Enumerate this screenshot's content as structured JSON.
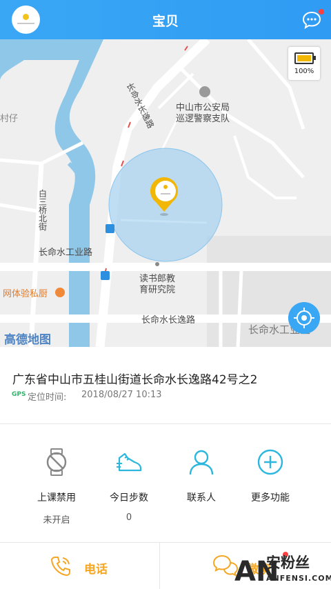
{
  "header": {
    "title": "宝贝"
  },
  "map": {
    "labels": {
      "police": "中山市公安局\n巡逻警察支队",
      "police_line1": "中山市公安局",
      "police_line2": "巡逻警察支队",
      "road_main": "长命水长逸路",
      "road_industrial": "长命水工业路",
      "road_bottom": "长命水长逸路",
      "district_right": "长命水工业区",
      "baisan_road": "白三桥北街",
      "research_line1": "读书郎教",
      "research_line2": "育研究院",
      "kitchen": "网体验私厨",
      "left_edge": "村仔"
    },
    "battery": {
      "percent_label": "100%",
      "level": 1.0
    },
    "logo": "高德地图"
  },
  "location": {
    "address": "广东省中山市五桂山街道长命水长逸路42号之2",
    "source": "GPS",
    "time_label": "定位时间:",
    "time_value": "2018/08/27 10:13"
  },
  "functions": [
    {
      "label": "上课禁用",
      "value": "未开启",
      "icon": "watch-disabled-icon"
    },
    {
      "label": "今日步数",
      "value": "0",
      "icon": "sneaker-icon"
    },
    {
      "label": "联系人",
      "value": "",
      "icon": "person-icon"
    },
    {
      "label": "更多功能",
      "value": "",
      "icon": "plus-circle-icon"
    }
  ],
  "bottom": {
    "call_label": "电话",
    "wechat_label": "微聊"
  },
  "watermark": {
    "main": "安粉丝",
    "sub": "ANFENSI.COM",
    "letters": "AN"
  },
  "colors": {
    "header": "#2f9bf3",
    "accent_icon": "#2bb7dd",
    "action": "#f5a623",
    "gps": "#2fb36a"
  }
}
